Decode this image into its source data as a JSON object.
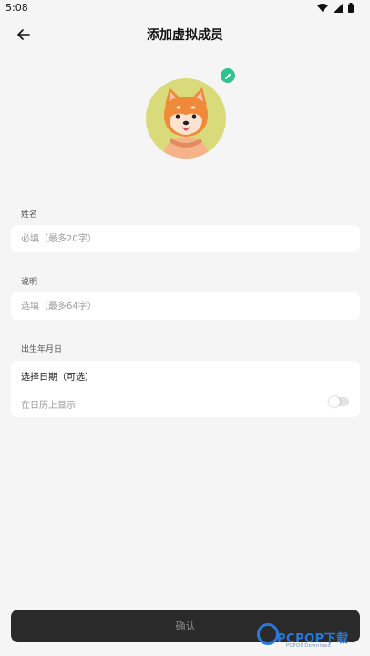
{
  "status_bar": {
    "time": "5:08"
  },
  "header": {
    "title": "添加虚拟成员"
  },
  "name_section": {
    "label": "姓名",
    "placeholder": "必填（最多20字）"
  },
  "desc_section": {
    "label": "说明",
    "placeholder": "选填（最多64字）"
  },
  "birthday_section": {
    "label": "出生年月日",
    "date_select": "选择日期（可选）",
    "show_on_calendar_label": "在日历上显示",
    "show_on_calendar_enabled": false
  },
  "footer": {
    "confirm_label": "确认"
  },
  "watermark": {
    "brand": "PCPOP下载",
    "sub": "PCPOP.Download"
  },
  "colors": {
    "accent": "#2fc28b",
    "avatar_bg": "#d9da7a",
    "button_bg": "#2a2a2a",
    "page_bg": "#f5f5f5"
  },
  "icons": [
    "back-arrow-icon",
    "edit-pencil-icon",
    "wifi-icon",
    "signal-icon",
    "battery-icon"
  ]
}
